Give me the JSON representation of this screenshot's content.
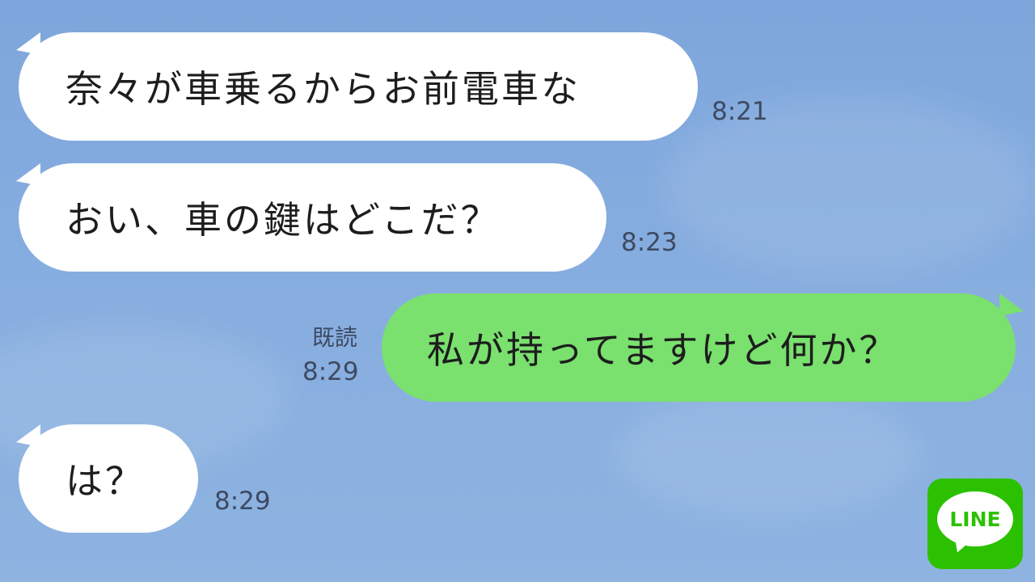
{
  "chat": {
    "messages": [
      {
        "side": "incoming",
        "text": "奈々が車乗るからお前電車な",
        "time": "8:21"
      },
      {
        "side": "incoming",
        "text": "おい、車の鍵はどこだ？",
        "time": "8:23"
      },
      {
        "side": "outgoing",
        "text": "私が持ってますけど何か？",
        "read": "既読",
        "time": "8:29"
      },
      {
        "side": "incoming",
        "text": "は？",
        "time": "8:29"
      }
    ]
  },
  "logo": {
    "text": "LINE",
    "icon": "line-app-icon"
  },
  "colors": {
    "background": "#82a9de",
    "incoming_bubble": "#ffffff",
    "outgoing_bubble": "#7ae06e",
    "timestamp": "#3e4a63",
    "logo": "#2cc100"
  }
}
